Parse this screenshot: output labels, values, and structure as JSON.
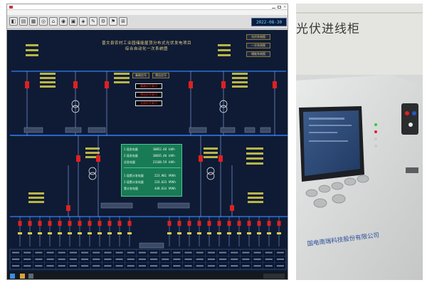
{
  "window": {
    "title": "",
    "datetime": "2022-08-30 16:0?"
  },
  "toolbar": {
    "buttons": [
      {
        "icon": "tool-icon-1"
      },
      {
        "icon": "tool-icon-2"
      },
      {
        "icon": "tool-icon-3"
      },
      {
        "icon": "tool-icon-4"
      },
      {
        "icon": "tool-icon-5"
      },
      {
        "icon": "tool-icon-6"
      },
      {
        "icon": "tool-icon-7"
      },
      {
        "icon": "tool-icon-8"
      },
      {
        "icon": "tool-icon-9"
      },
      {
        "icon": "tool-icon-10"
      },
      {
        "icon": "tool-icon-11"
      },
      {
        "icon": "tool-icon-12"
      }
    ]
  },
  "scada": {
    "title_line1": "晋文县农村工业园储能屋顶分布式光伏发电项目",
    "title_line2": "综合自动化一次系统图",
    "nav_buttons": [
      {
        "label": "光伏系统图"
      },
      {
        "label": "一次系统图"
      },
      {
        "label": "储能系统图"
      }
    ],
    "control_buttons": [
      {
        "label": "事故信号"
      },
      {
        "label": "预告信号"
      }
    ],
    "alarm_buttons": [
      {
        "label": "事故信号复归"
      },
      {
        "label": "预告信号复归"
      },
      {
        "label": "全部信号复归"
      }
    ],
    "energy_panel": {
      "rows_top": [
        {
          "label": "1 段发电量",
          "value": "10052.48",
          "unit": "kWh"
        },
        {
          "label": "2 段发电量",
          "value": "10835.40",
          "unit": "kWh"
        },
        {
          "label": "总发电量",
          "value": "21108.59",
          "unit": "kWh"
        }
      ],
      "rows_bottom": [
        {
          "label": "1 段累计发电量",
          "value": "223.981",
          "unit": "MWh"
        },
        {
          "label": "2 段累计发电量",
          "value": "224.633",
          "unit": "MWh"
        },
        {
          "label": "累计发电量",
          "value": "448.614",
          "unit": "MWh"
        }
      ]
    }
  },
  "photo": {
    "sign_text": "光伏进线柜",
    "panel_brand": "国电南瑞科技股份有限公司",
    "panel_brand_tail": "股份有限公司"
  },
  "colors": {
    "canvas_bg": "#0f1b34",
    "bus_blue": "#2f7fff",
    "breaker_red": "#e02020",
    "energy_panel": "#197b55",
    "label_gold": "#e8d48a"
  }
}
